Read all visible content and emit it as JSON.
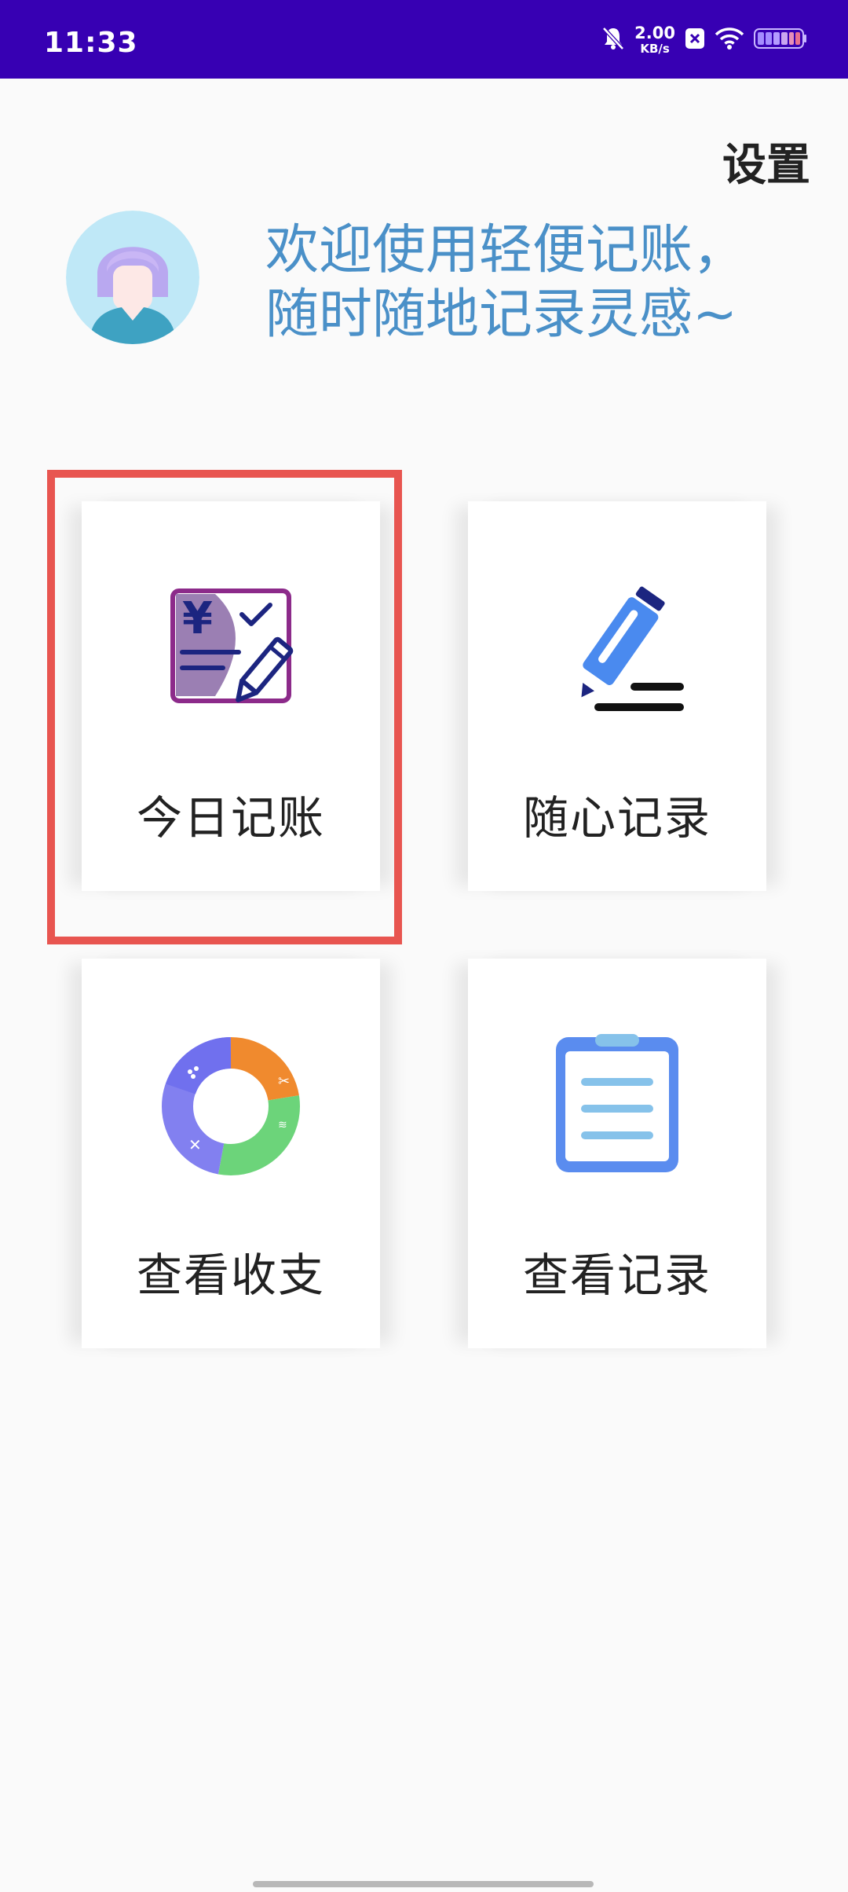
{
  "status_bar": {
    "time": "11:33",
    "net_speed_value": "2.00",
    "net_speed_unit": "KB/s",
    "background": "#3700b3",
    "icons": [
      "bell-muted-icon",
      "close-box-icon",
      "wifi-icon",
      "battery-icon"
    ]
  },
  "header": {
    "settings_label": "设置",
    "welcome_line1": "欢迎使用轻便记账，",
    "welcome_line2": "随时随地记录灵感~",
    "welcome_color": "#4a90c8"
  },
  "cards": [
    {
      "label": "今日记账",
      "icon": "bill-edit-icon",
      "highlighted": true
    },
    {
      "label": "随心记录",
      "icon": "pen-icon",
      "highlighted": false
    },
    {
      "label": "查看收支",
      "icon": "donut-chart-icon",
      "highlighted": false
    },
    {
      "label": "查看记录",
      "icon": "clipboard-list-icon",
      "highlighted": false
    }
  ],
  "colors": {
    "highlight_border": "#e85550",
    "accent_blue": "#4a90c8"
  }
}
